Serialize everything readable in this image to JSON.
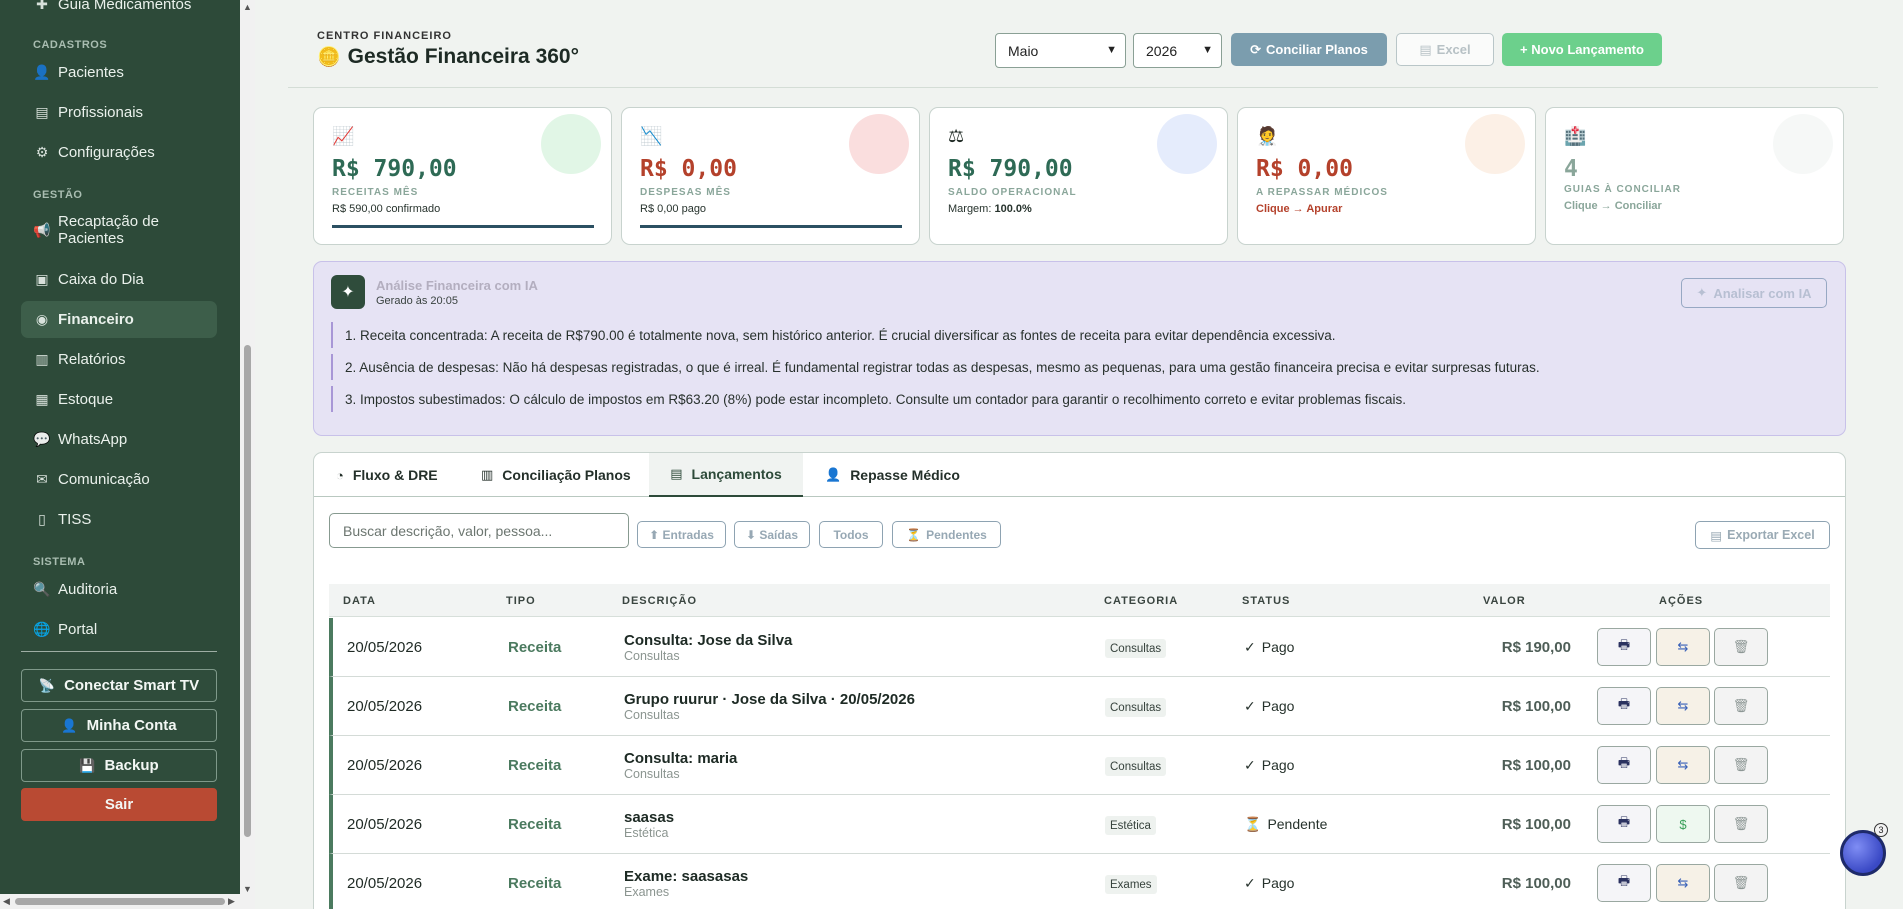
{
  "sidebar": {
    "top_item": "Guia Medicamentos",
    "sections": {
      "cadastros": "CADASTROS",
      "gestao": "GESTÃO",
      "sistema": "SISTEMA"
    },
    "items": [
      {
        "label": "Pacientes",
        "icon": "user-icon"
      },
      {
        "label": "Profissionais",
        "icon": "id-card-icon"
      },
      {
        "label": "Configurações",
        "icon": "gear-icon"
      },
      {
        "label": "Recaptação de Pacientes",
        "icon": "megaphone-icon"
      },
      {
        "label": "Caixa do Dia",
        "icon": "cash-register-icon"
      },
      {
        "label": "Financeiro",
        "icon": "finance-icon"
      },
      {
        "label": "Relatórios",
        "icon": "chart-icon"
      },
      {
        "label": "Estoque",
        "icon": "box-icon"
      },
      {
        "label": "WhatsApp",
        "icon": "whatsapp-icon"
      },
      {
        "label": "Comunicação",
        "icon": "envelope-icon"
      },
      {
        "label": "TISS",
        "icon": "file-icon"
      },
      {
        "label": "Auditoria",
        "icon": "search-icon"
      },
      {
        "label": "Portal",
        "icon": "globe-icon"
      }
    ],
    "buttons": {
      "smart_tv": "Conectar Smart TV",
      "account": "Minha Conta",
      "backup": "Backup",
      "logout": "Sair"
    }
  },
  "header": {
    "kicker": "CENTRO FINANCEIRO",
    "title": "Gestão Financeira 360°",
    "month": "Maio",
    "year": "2026",
    "conciliar": "Conciliar Planos",
    "excel": "Excel",
    "novo": "+ Novo Lançamento"
  },
  "cards": [
    {
      "value": "R$ 790,00",
      "label": "RECEITAS MÊS",
      "sub": "R$ 590,00 confirmado",
      "icon": "trend-up-icon",
      "color": "#2e6a55"
    },
    {
      "value": "R$ 0,00",
      "label": "DESPESAS MÊS",
      "sub": "R$ 0,00 pago",
      "icon": "trend-down-icon",
      "color": "#b4412b"
    },
    {
      "value": "R$ 790,00",
      "label": "SALDO OPERACIONAL",
      "sub_label": "Margem:",
      "sub_value": "100.0%",
      "icon": "scale-icon",
      "color": "#2e6a55"
    },
    {
      "value": "R$ 0,00",
      "label": "A REPASSAR MÉDICOS",
      "sub": "Clique → Apurar",
      "icon": "doctor-icon",
      "color": "#b4412b"
    },
    {
      "value": "4",
      "label": "GUIAS À CONCILIAR",
      "sub": "Clique → Conciliar",
      "icon": "hospital-icon",
      "color": "#8aa69a"
    }
  ],
  "ai": {
    "title": "Análise Financeira com IA",
    "generated": "Gerado às 20:05",
    "button": "Analisar com IA",
    "lines": [
      "1. Receita concentrada: A receita de R$790.00 é totalmente nova, sem histórico anterior. É crucial diversificar as fontes de receita para evitar dependência excessiva.",
      "2. Ausência de despesas: Não há despesas registradas, o que é irreal. É fundamental registrar todas as despesas, mesmo as pequenas, para uma gestão financeira precisa e evitar surpresas futuras.",
      "3. Impostos subestimados: O cálculo de impostos em R$63.20 (8%) pode estar incompleto. Consulte um contador para garantir o recolhimento correto e evitar problemas fiscais."
    ]
  },
  "tabs": [
    {
      "label": "Fluxo & DRE",
      "icon": "pie-chart-icon"
    },
    {
      "label": "Conciliação Planos",
      "icon": "clinic-icon"
    },
    {
      "label": "Lançamentos",
      "icon": "document-icon"
    },
    {
      "label": "Repasse Médico",
      "icon": "doctor-icon"
    }
  ],
  "filters": {
    "search_placeholder": "Buscar descrição, valor, pessoa...",
    "entradas": "⬆ Entradas",
    "saidas": "⬇ Saídas",
    "todos": "Todos",
    "pendentes": "Pendentes",
    "export": "Exportar Excel"
  },
  "table": {
    "headers": [
      "DATA",
      "TIPO",
      "DESCRIÇÃO",
      "CATEGORIA",
      "STATUS",
      "VALOR",
      "AÇÕES"
    ],
    "rows": [
      {
        "data": "20/05/2026",
        "tipo": "Receita",
        "desc": "Consulta: Jose da Silva",
        "sub": "Consultas",
        "cat": "Consultas",
        "status": "Pago",
        "status_icon": "check-icon",
        "valor": "R$ 190,00",
        "action": "refund-icon"
      },
      {
        "data": "20/05/2026",
        "tipo": "Receita",
        "desc": "Grupo ruurur · Jose da Silva · 20/05/2026",
        "sub": "Consultas",
        "cat": "Consultas",
        "status": "Pago",
        "status_icon": "check-icon",
        "valor": "R$ 100,00",
        "action": "refund-icon"
      },
      {
        "data": "20/05/2026",
        "tipo": "Receita",
        "desc": "Consulta: maria",
        "sub": "Consultas",
        "cat": "Consultas",
        "status": "Pago",
        "status_icon": "check-icon",
        "valor": "R$ 100,00",
        "action": "refund-icon"
      },
      {
        "data": "20/05/2026",
        "tipo": "Receita",
        "desc": "saasas",
        "sub": "Estética",
        "cat": "Estética",
        "status": "Pendente",
        "status_icon": "hourglass-icon",
        "valor": "R$ 100,00",
        "action": "dollar-icon"
      },
      {
        "data": "20/05/2026",
        "tipo": "Receita",
        "desc": "Exame: saasasas",
        "sub": "Exames",
        "cat": "Exames",
        "status": "Pago",
        "status_icon": "check-icon",
        "valor": "R$ 100,00",
        "action": "refund-icon"
      }
    ]
  },
  "chat": {
    "badge": "3"
  }
}
